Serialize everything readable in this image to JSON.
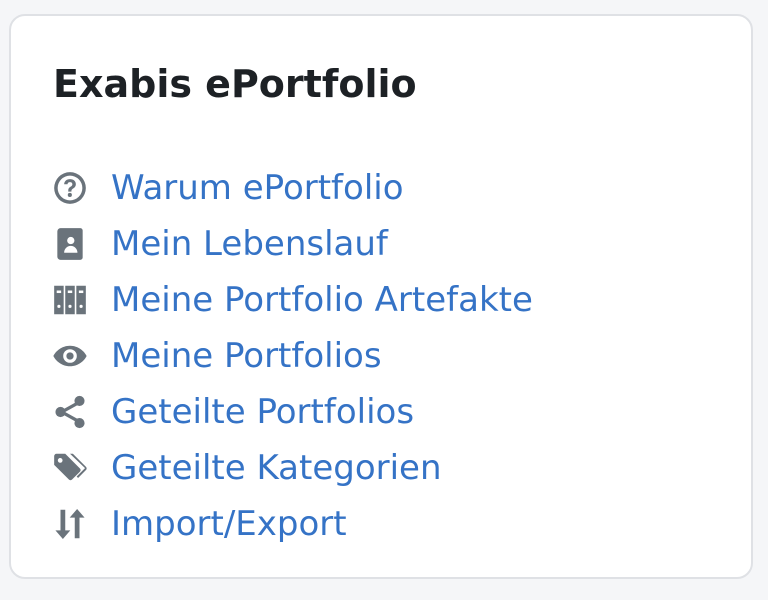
{
  "block": {
    "title": "Exabis ePortfolio",
    "colors": {
      "link": "#3573c6",
      "icon": "#6a737b",
      "title": "#1d2125",
      "border": "#dfe1e5"
    },
    "items": [
      {
        "label": "Warum ePortfolio",
        "icon": "question-circle-icon"
      },
      {
        "label": "Mein Lebenslauf",
        "icon": "contact-book-icon"
      },
      {
        "label": "Meine Portfolio Artefakte",
        "icon": "binders-icon"
      },
      {
        "label": "Meine Portfolios",
        "icon": "eye-icon"
      },
      {
        "label": "Geteilte Portfolios",
        "icon": "share-icon"
      },
      {
        "label": "Geteilte Kategorien",
        "icon": "tags-icon"
      },
      {
        "label": "Import/Export",
        "icon": "import-export-icon"
      }
    ]
  }
}
